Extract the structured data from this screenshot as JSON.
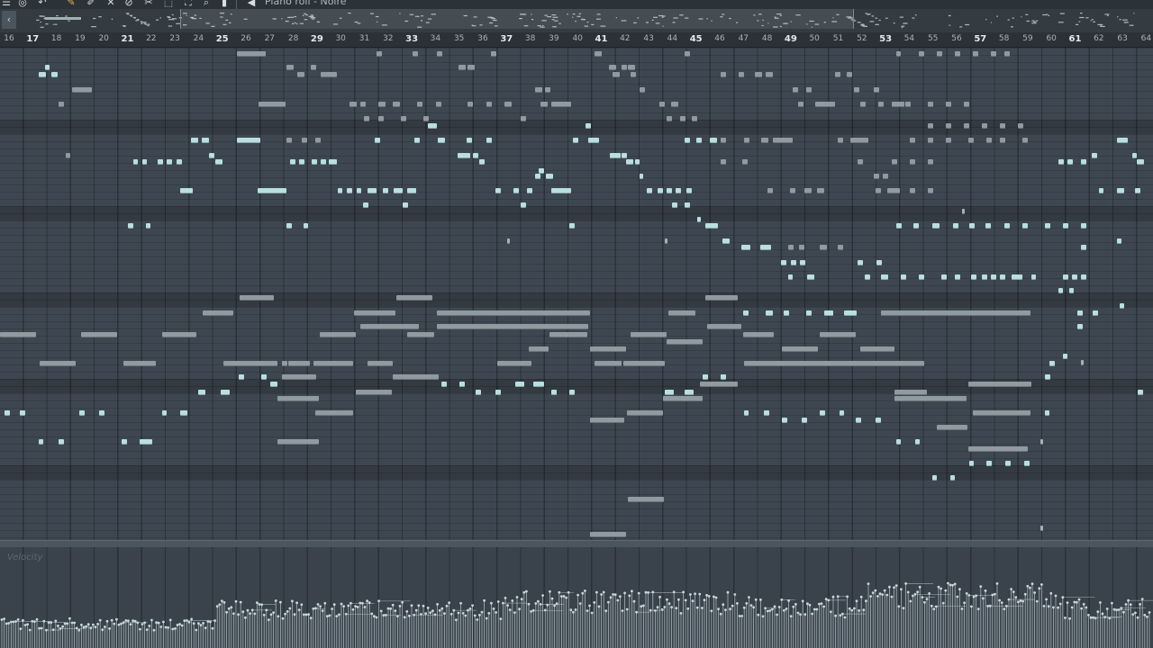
{
  "window": {
    "title": "Piano roll - Noire"
  },
  "toolbar": {
    "icons": [
      "menu-icon",
      "stamp-icon",
      "magnet-icon",
      "pencil-icon",
      "paintbrush-icon",
      "delete-icon",
      "mute-icon",
      "slice-icon",
      "select-icon",
      "zoom-icon",
      "playback-icon",
      "speaker-icon"
    ]
  },
  "overview": {
    "back_label": "‹"
  },
  "ruler": {
    "bars": [
      "16",
      "17",
      "18",
      "19",
      "20",
      "21",
      "22",
      "23",
      "24",
      "25",
      "26",
      "27",
      "28",
      "29",
      "30",
      "31",
      "32",
      "33",
      "34",
      "35",
      "36",
      "37",
      "38",
      "39",
      "40",
      "41",
      "42",
      "43",
      "44",
      "45",
      "46",
      "47",
      "48",
      "49",
      "50",
      "51",
      "52",
      "53",
      "54",
      "55",
      "56",
      "57",
      "58",
      "59",
      "60",
      "61",
      "62",
      "63",
      "64"
    ],
    "major_bars": [
      "17",
      "21",
      "25",
      "29",
      "33",
      "37",
      "41",
      "45",
      "49",
      "53",
      "57",
      "61"
    ]
  },
  "velocity": {
    "label": "Velocity"
  },
  "colors": {
    "note": "#b9dfe0",
    "note_dim": "#8f9aa1",
    "grid_bg": "#3e4751",
    "toolbar_bg": "#2c3338",
    "ruler_bg": "#2b3237",
    "velocity_stem": "#c6d9dc"
  }
}
